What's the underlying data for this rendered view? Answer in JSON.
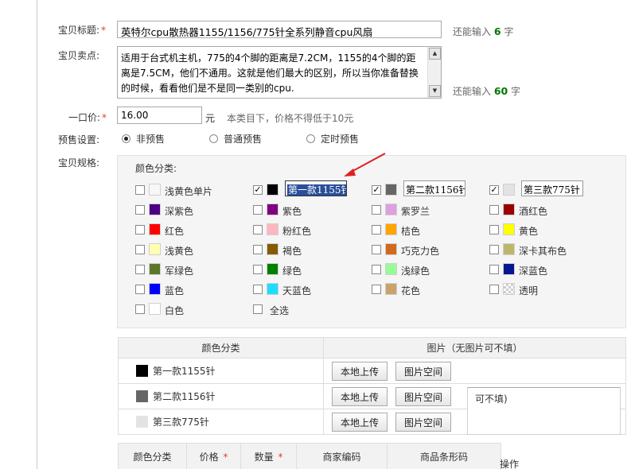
{
  "form": {
    "title_label": "宝贝标题:",
    "title_value": "英特尔cpu散热器1155/1156/775针全系列静音cpu风扇",
    "title_hint_pre": "还能输入",
    "title_hint_count": "6",
    "title_hint_post": "字",
    "sell_label": "宝贝卖点:",
    "sell_text": "适用于台式机主机，775的4个脚的距离是7.2CM，1155的4个脚的距离是7.5CM，他们不通用。这就是他们最大的区别，所以当你准备替换的时候，看看他们是不是同一类别的cpu.",
    "sell_hint_pre": "还能输入",
    "sell_hint_count": "60",
    "sell_hint_post": "字",
    "price_label": "一口价:",
    "price_value": "16.00",
    "price_unit": "元",
    "price_note": "本类目下，价格不得低于10元",
    "presale_label": "预售设置:",
    "presale_options": [
      "非预售",
      "普通预售",
      "定时预售"
    ],
    "presale_selected": "非预售",
    "spec_label": "宝贝规格:",
    "required_mark": "*"
  },
  "spec": {
    "color_title": "颜色分类:",
    "colors": [
      {
        "name": "浅黄色单片",
        "swatch": "#f7f7f7",
        "checked": false
      },
      {
        "name": "第一款1155针",
        "swatch": "#000000",
        "checked": true,
        "editing": true
      },
      {
        "name": "第二款1156针",
        "swatch": "#666666",
        "checked": true
      },
      {
        "name": "第三款775针",
        "swatch": "#e3e3e3",
        "checked": true
      },
      {
        "name": "深紫色",
        "swatch": "#4b0082",
        "checked": false
      },
      {
        "name": "紫色",
        "swatch": "#800080",
        "checked": false
      },
      {
        "name": "紫罗兰",
        "swatch": "#dda0dd",
        "checked": false
      },
      {
        "name": "酒红色",
        "swatch": "#990000",
        "checked": false
      },
      {
        "name": "红色",
        "swatch": "#ff0000",
        "checked": false
      },
      {
        "name": "粉红色",
        "swatch": "#ffb6c1",
        "checked": false
      },
      {
        "name": "桔色",
        "swatch": "#ffa500",
        "checked": false
      },
      {
        "name": "黄色",
        "swatch": "#ffff00",
        "checked": false
      },
      {
        "name": "浅黄色",
        "swatch": "#ffffb1",
        "checked": false
      },
      {
        "name": "褐色",
        "swatch": "#855b00",
        "checked": false
      },
      {
        "name": "巧克力色",
        "swatch": "#d2691e",
        "checked": false
      },
      {
        "name": "深卡其布色",
        "swatch": "#bdb76b",
        "checked": false
      },
      {
        "name": "军绿色",
        "swatch": "#5d762a",
        "checked": false
      },
      {
        "name": "绿色",
        "swatch": "#008000",
        "checked": false
      },
      {
        "name": "浅绿色",
        "swatch": "#98fb98",
        "checked": false
      },
      {
        "name": "深蓝色",
        "swatch": "#041690",
        "checked": false
      },
      {
        "name": "蓝色",
        "swatch": "#0000fe",
        "checked": false
      },
      {
        "name": "天蓝色",
        "swatch": "#1eddff",
        "checked": false
      },
      {
        "name": "花色",
        "swatch": "#c9a36b",
        "checked": false
      },
      {
        "name": "透明",
        "swatch": "transparent",
        "checked": false
      },
      {
        "name": "白色",
        "swatch": "#ffffff",
        "checked": false
      }
    ],
    "select_all": "全选"
  },
  "image_table": {
    "col_color": "颜色分类",
    "col_image": "图片（无图片可不填）",
    "rows": [
      {
        "name": "第一款1155针",
        "swatch": "#000000"
      },
      {
        "name": "第二款1156针",
        "swatch": "#666666"
      },
      {
        "name": "第三款775针",
        "swatch": "#e3e3e3"
      }
    ],
    "upload_label": "本地上传",
    "space_label": "图片空间",
    "ghost_text": "可不填)"
  },
  "sku_table": {
    "headers": [
      "颜色分类",
      "价格",
      "数量",
      "商家编码",
      "商品条形码"
    ],
    "required_cols": [
      "价格",
      "数量"
    ],
    "op_label": "操作"
  },
  "colors": {
    "required": "#e4393c",
    "hint_count": "#007700",
    "arrow": "#e02020",
    "selection": "#2a4f9a"
  }
}
